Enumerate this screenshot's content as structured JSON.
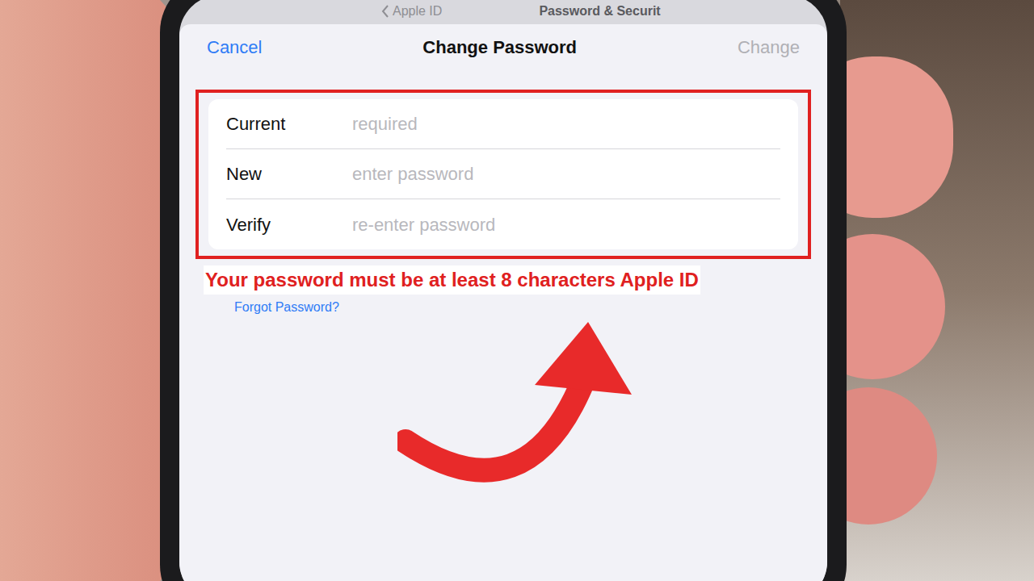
{
  "nav": {
    "back": "Apple ID",
    "title": "Password & Securit"
  },
  "sheet": {
    "title": "Change Password",
    "cancel": "Cancel",
    "confirm": {
      "label": "Change",
      "disabled": true
    }
  },
  "fields": [
    {
      "label": "Current",
      "placeholder": "required"
    },
    {
      "label": "New",
      "placeholder": "enter password"
    },
    {
      "label": "Verify",
      "placeholder": "re-enter password"
    }
  ],
  "caption": "Your password must be at least 8 characters Apple ID",
  "link": "Forgot Password?"
}
